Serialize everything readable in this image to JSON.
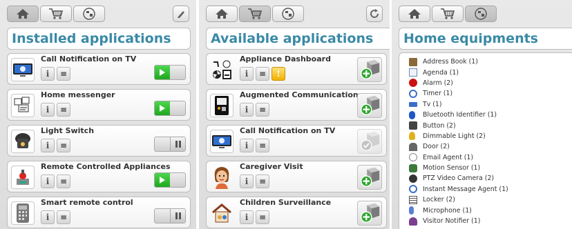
{
  "installed": {
    "title": "Installed applications",
    "apps": [
      {
        "name": "Call Notification on TV",
        "state": "on"
      },
      {
        "name": "Home messenger",
        "state": "on"
      },
      {
        "name": "Light Switch",
        "state": "off"
      },
      {
        "name": "Remote Controlled Appliances",
        "state": "on"
      },
      {
        "name": "Smart remote control",
        "state": "off"
      }
    ]
  },
  "available": {
    "title": "Available applications",
    "apps": [
      {
        "name": "Appliance Dashboard",
        "has_warning": true,
        "installed": false
      },
      {
        "name": "Augmented Communication",
        "has_warning": false,
        "installed": false
      },
      {
        "name": "Call Notification on TV",
        "has_warning": false,
        "installed": true
      },
      {
        "name": "Caregiver Visit",
        "has_warning": false,
        "installed": false
      },
      {
        "name": "Children Surveillance",
        "has_warning": false,
        "installed": false
      }
    ]
  },
  "equipments": {
    "title": "Home equipments",
    "items": [
      {
        "label": "Address Book (1)",
        "icon": "address-book-icon",
        "color": "#8a6a3a"
      },
      {
        "label": "Agenda (1)",
        "icon": "agenda-icon",
        "color": "#6a8ab5"
      },
      {
        "label": "Alarm (2)",
        "icon": "alarm-icon",
        "color": "#cc1111"
      },
      {
        "label": "Timer (1)",
        "icon": "timer-icon",
        "color": "#3a6fc9"
      },
      {
        "label": "Tv (1)",
        "icon": "tv-icon",
        "color": "#3a6fc9"
      },
      {
        "label": "Bluetooth Identifier (1)",
        "icon": "bluetooth-icon",
        "color": "#1f57c4"
      },
      {
        "label": "Button (2)",
        "icon": "button-icon",
        "color": "#444444"
      },
      {
        "label": "Dimmable Light (2)",
        "icon": "light-bulb-icon",
        "color": "#e0b020"
      },
      {
        "label": "Door (2)",
        "icon": "door-icon",
        "color": "#666666"
      },
      {
        "label": "Email Agent (1)",
        "icon": "email-icon",
        "color": "#888888"
      },
      {
        "label": "Motion Sensor (1)",
        "icon": "motion-sensor-icon",
        "color": "#3c7a3c"
      },
      {
        "label": "PTZ Video Camera (2)",
        "icon": "camera-icon",
        "color": "#333333"
      },
      {
        "label": "Instant Message Agent (1)",
        "icon": "chat-icon",
        "color": "#3a6fc9"
      },
      {
        "label": "Locker (2)",
        "icon": "locker-icon",
        "color": "#555555"
      },
      {
        "label": "Microphone (1)",
        "icon": "microphone-icon",
        "color": "#5a7fd4"
      },
      {
        "label": "Visitor Notifier (1)",
        "icon": "visitor-icon",
        "color": "#7a3f8f"
      }
    ]
  },
  "colors": {
    "title": "#3a8aa6",
    "toggle_on": "#2bbf2b",
    "install_green": "#2ea82e"
  }
}
